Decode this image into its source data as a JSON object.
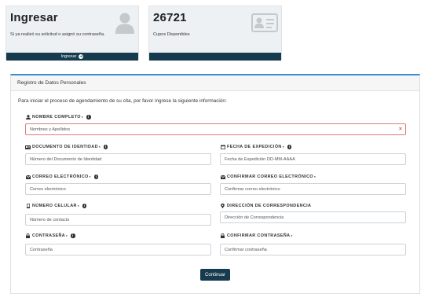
{
  "login_card": {
    "title": "Ingresar",
    "subtitle": "Si ya realizó su solicitud o asignó su contraseña.",
    "button_label": "Ingresar",
    "icon": "user-icon"
  },
  "quota_card": {
    "count": "26721",
    "subtitle": "Cupos Disponibles",
    "icon": "id-card-icon"
  },
  "form": {
    "panel_title": "Registro de Datos Personales",
    "intro": "Para iniciar el proceso de agendamiento de su cita, por favor ingrese la siguiente información:",
    "fields": {
      "full_name": {
        "label": "NOMBRE COMPLETO",
        "required": "*",
        "placeholder": "Nombres y Apellidos",
        "icon": "user-icon"
      },
      "id_document": {
        "label": "DOCUMENTO DE IDENTIDAD",
        "required": "*",
        "placeholder": "Número del Documento de Identidad",
        "icon": "id-card-icon"
      },
      "issue_date": {
        "label": "FECHA DE EXPEDICIÓN",
        "required": "*",
        "placeholder": "Fecha de Expedición DD-MM-AAAA",
        "icon": "calendar-icon"
      },
      "email": {
        "label": "CORREO ELECTRÓNICO",
        "required": "*",
        "placeholder": "Correo electrónico",
        "icon": "envelope-icon"
      },
      "email_confirm": {
        "label": "CONFIRMAR CORREO ELECTRÓNICO",
        "required": "*",
        "placeholder": "Confirmar correo electrónico",
        "icon": "envelope-icon"
      },
      "phone": {
        "label": "NÚMERO CELULAR",
        "required": "*",
        "placeholder": "Número de contacto",
        "icon": "mobile-icon"
      },
      "address": {
        "label": "DIRECCIÓN DE CORRESPONDENCIA",
        "required": "",
        "placeholder": "Dirección de Correspondencia",
        "icon": "map-marker-icon"
      },
      "password": {
        "label": "CONTRASEÑA",
        "required": "*",
        "placeholder": "Contraseña",
        "icon": "lock-icon"
      },
      "password_confirm": {
        "label": "CONFIRMAR CONTRASEÑA",
        "required": "*",
        "placeholder": "Confirmar contraseña",
        "icon": "lock-icon"
      }
    },
    "submit_label": "Continuar"
  },
  "colors": {
    "brand_dark": "#163a4e",
    "accent_blue": "#3b8fd0",
    "error_red": "#d9534f"
  }
}
